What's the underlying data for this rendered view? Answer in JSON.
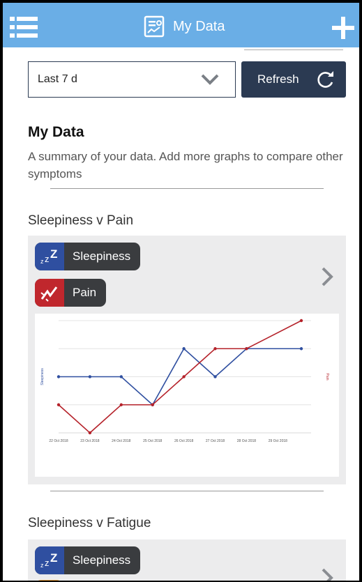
{
  "header": {
    "title": "My Data"
  },
  "filter": {
    "range_value": "Last 7 d",
    "refresh_label": "Refresh"
  },
  "summary": {
    "title": "My Data",
    "description": "A summary of your data. Add more graphs to compare other symptoms"
  },
  "graphs": [
    {
      "title": "Sleepiness v Pain",
      "tags": [
        {
          "label": "Sleepiness",
          "icon": "sleep-zz-icon",
          "color": "#2f4fa0"
        },
        {
          "label": "Pain",
          "icon": "lightning-icon",
          "color": "#c0272d"
        }
      ]
    },
    {
      "title": "Sleepiness v Fatigue",
      "tags": [
        {
          "label": "Sleepiness",
          "icon": "sleep-zz-icon",
          "color": "#2f4fa0"
        }
      ]
    }
  ],
  "chart_data": {
    "type": "line",
    "categories": [
      "22 Oct 2018",
      "23 Oct 2018",
      "24 Oct 2018",
      "25 Oct 2018",
      "26 Oct 2018",
      "27 Oct 2018",
      "28 Oct 2018",
      "29 Oct 2018"
    ],
    "ylabel": "Sleepiness",
    "y2label": "Pain",
    "ylim": [
      0,
      4
    ],
    "grid": true,
    "series": [
      {
        "name": "Sleepiness",
        "color": "#2f4fa0",
        "x": [
          0,
          1,
          2,
          3,
          4,
          5,
          6,
          7.75
        ],
        "values": [
          2,
          2,
          2,
          1,
          3,
          2,
          3,
          3
        ]
      },
      {
        "name": "Pain",
        "color": "#b5222a",
        "x": [
          0,
          1,
          2,
          3,
          4,
          5,
          6,
          7.75
        ],
        "values": [
          1,
          0,
          1,
          1,
          2,
          3,
          3,
          4
        ]
      }
    ]
  }
}
